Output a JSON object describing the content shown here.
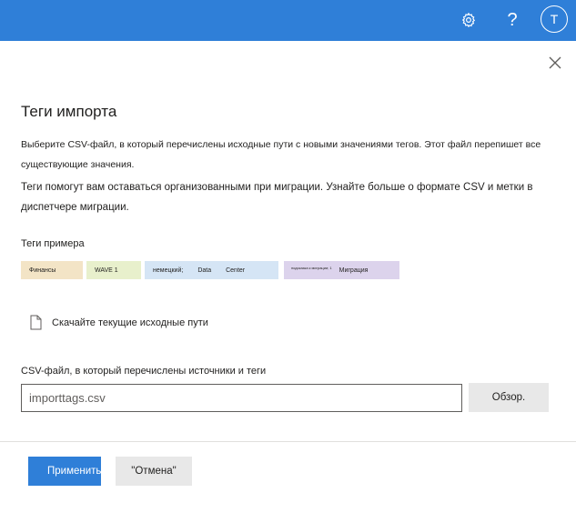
{
  "header": {
    "avatar_initial": "T",
    "help_symbol": "?",
    "icons": [
      "gear-icon",
      "help-icon",
      "avatar",
      "close-icon"
    ],
    "bar_color": "#2f7fd8"
  },
  "dialog": {
    "title": "Теги импорта",
    "para1": "Выберите CSV-файл, в который перечислены исходные пути с новыми значениями тегов. Этот файл перепишет все существующие значения.",
    "para2": "Теги помогут вам оставаться организованными при миграции. Узнайте больше о формате CSV и метки в диспетчере миграции.",
    "sample_label": "Теги примера",
    "tags": {
      "t1": "Финансы",
      "t2": "WAVE 1",
      "t3a": "немецкий;",
      "t3b": "Data",
      "t3c": "Center",
      "t4_small": "подсказка к миграции; 1",
      "t4": "Миграция"
    },
    "download_link": "Скачайте текущие исходные пути",
    "csv_label": "CSV-файл, в который перечислены источники и теги",
    "csv_value": "importtags.csv",
    "browse_button": "Обзор.",
    "apply_button": "Применить",
    "cancel_button": "\"Отмена\""
  },
  "colors": {
    "accent": "#2f7fd8",
    "tag_finance": "#f3e4c6",
    "tag_wave": "#e8f0cc",
    "tag_location": "#d5e5f5",
    "tag_migration": "#dcd3ec"
  }
}
